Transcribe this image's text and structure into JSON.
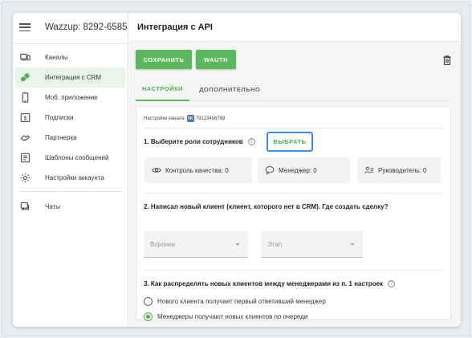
{
  "app": {
    "title": "Wazzup: 8292-6585"
  },
  "sidebar": {
    "items": [
      {
        "label": "Каналы",
        "icon": "channels-icon"
      },
      {
        "label": "Интеграция с CRM",
        "icon": "plug-icon"
      },
      {
        "label": "Моб. приложение",
        "icon": "mobile-icon"
      },
      {
        "label": "Подписки",
        "icon": "dollar-icon"
      },
      {
        "label": "Партнерка",
        "icon": "handshake-icon"
      },
      {
        "label": "Шаблоны сообщений",
        "icon": "template-icon"
      },
      {
        "label": "Настройки аккаунта",
        "icon": "gear-icon"
      }
    ],
    "chats": {
      "label": "Чаты",
      "icon": "chat-icon"
    }
  },
  "main": {
    "title": "Интеграция с API",
    "save_label": "СОХРАНИТЬ",
    "wauth_label": "WAUTH",
    "tabs": [
      {
        "label": "НАСТРОЙКИ",
        "active": true
      },
      {
        "label": "ДОПОЛНИТЕЛЬНО",
        "active": false
      }
    ]
  },
  "panel": {
    "channel_label": "Настройки канала",
    "channel_badge": "VK",
    "channel_id": "79123456789",
    "q1": "1. Выберите роли сотрудников",
    "choose_label": "ВЫБРАТЬ",
    "roles": [
      {
        "label": "Контроль качества: 0",
        "icon": "eye-icon"
      },
      {
        "label": "Менеджер: 0",
        "icon": "speech-icon"
      },
      {
        "label": "Руководитель: 0",
        "icon": "people-icon"
      }
    ],
    "q2": "2. Написал новый клиент (клиент, которого нет в CRM). Где создать сделку?",
    "funnel_placeholder": "Воронка",
    "stage_placeholder": "Этап",
    "q3": "3. Как распределять новых клиентов между менеджерами из п. 1 настроек",
    "options": [
      {
        "label": "Нового клиента получает первый ответивший менеджер",
        "selected": false
      },
      {
        "label": "Менеджеры получают новых клиентов по очереди",
        "selected": true
      }
    ]
  },
  "colors": {
    "accent_green": "#5cb85c",
    "focus_blue": "#3d8ee8",
    "vk_blue": "#4a76a8"
  }
}
